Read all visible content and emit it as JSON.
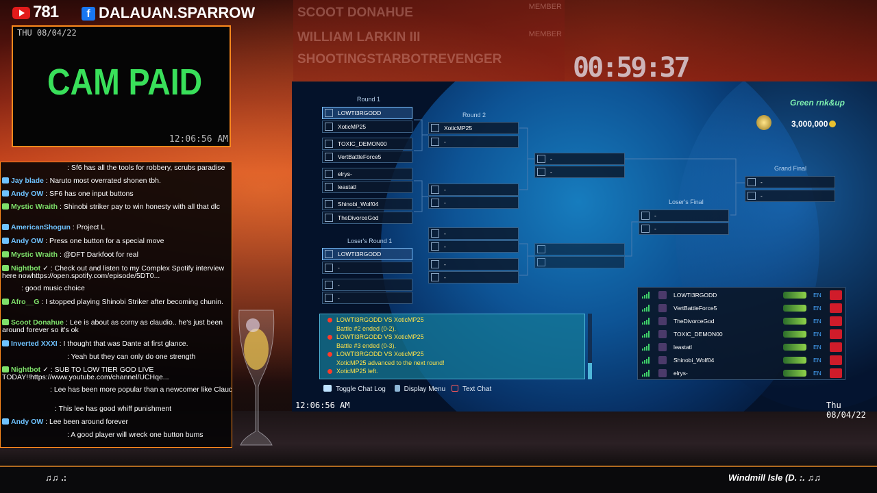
{
  "stats": {
    "youtube_count": "781",
    "facebook_name": "DALAUAN.SPARROW"
  },
  "cam": {
    "date": "THU 08/04/22",
    "label": "CAM PAID",
    "time": "12:06:56 AM"
  },
  "chat": [
    {
      "user": "",
      "text": ": Sf6 has all the tools for robbery, scrubs paradise",
      "color": "#ffffff"
    },
    {
      "user": "Jay blade",
      "text": ": Naruto most overrated shonen tbh.",
      "color": "#6fc3ff"
    },
    {
      "user": "Andy OW",
      "text": ": SF6 has one input buttons",
      "color": "#6fc3ff"
    },
    {
      "user": "Mystic Wraith",
      "text": ": Shinobi striker pay to win honesty with all that dlc",
      "color": "#7ee06a"
    },
    {
      "user": "AmericanShogun",
      "text": ": Project L",
      "color": "#6fc3ff"
    },
    {
      "user": "Andy OW",
      "text": ": Press one button for a special move",
      "color": "#6fc3ff"
    },
    {
      "user": "Mystic Wraith",
      "text": ": @DFT Darkfoot for real",
      "color": "#7ee06a"
    },
    {
      "user": "Nightbot",
      "text": "✓ : Check out and listen to my Complex Spotify interview here nowhttps://open.spotify.com/episode/5DT0...",
      "color": "#7ee06a"
    },
    {
      "user": "",
      "text": ": good music choice",
      "color": "#ffffff"
    },
    {
      "user": "Afro__G",
      "text": ": I stopped playing Shinobi Striker after becoming chunin.",
      "color": "#7ee06a"
    },
    {
      "user": "Scoot Donahue",
      "text": ": Lee is about as corny as claudio.. he's just been around forever so it's ok",
      "color": "#7ee06a"
    },
    {
      "user": "Inverted XXXI",
      "text": ": I thought that was Dante at first glance.",
      "color": "#6fc3ff"
    },
    {
      "user": "",
      "text": ": Yeah but they can only do one strength",
      "color": "#ffffff"
    },
    {
      "user": "Nightbot",
      "text": "✓ : SUB TO LOW TIER GOD LIVE TODAY!!https://www.youtube.com/channel/UCHqe...",
      "color": "#7ee06a"
    },
    {
      "user": "",
      "text": ": Lee has been more popular than a newcomer like Claudio",
      "color": "#ffffff"
    },
    {
      "user": "",
      "text": ": This lee has good whiff punishment",
      "color": "#ffffff"
    },
    {
      "user": "Andy OW",
      "text": ": Lee been around forever",
      "color": "#6fc3ff"
    },
    {
      "user": "",
      "text": ": A good player will wreck one button bums",
      "color": "#ffffff"
    }
  ],
  "ghost_list": [
    {
      "name": "SCOOT DONAHUE",
      "tag": "MEMBER"
    },
    {
      "name": "WILLIAM LARKIN III",
      "tag": "MEMBER"
    },
    {
      "name": "SHOOTINGSTARBOTREVENGER",
      "tag": ""
    }
  ],
  "timer": "00:59:37",
  "bracket": {
    "round1": "Round 1",
    "round2": "Round 2",
    "losers_round1": "Loser's Round 1",
    "losers_final": "Loser's Final",
    "grand_final": "Grand Final",
    "slots_round1": [
      "LOWTI3RGODD",
      "XoticMP25",
      "TOXIC_DEMON00",
      "VertBattleForce5",
      "elrys-",
      "leastatl",
      "Shinobi_Wolf04",
      "TheDivorceGod"
    ],
    "slot_round2_1": "XoticMP25",
    "slot_losers1_1": "LOWTI3RGODD",
    "empty": "-"
  },
  "prize": {
    "label": "Green rnk&up",
    "value": "3,000,000"
  },
  "log": [
    {
      "text": "LOWTI3RGODD VS XoticMP25",
      "dot": true
    },
    {
      "text": "Battle #2 ended (0-2).",
      "dot": false
    },
    {
      "text": "LOWTI3RGODD VS XoticMP25",
      "dot": true
    },
    {
      "text": "Battle #3 ended (0-3).",
      "dot": false
    },
    {
      "text": "LOWTI3RGODD VS XoticMP25",
      "dot": true
    },
    {
      "text": "XoticMP25 advanced to the next round!",
      "dot": false
    },
    {
      "text": "XoticMP25 left.",
      "dot": true
    }
  ],
  "hints": {
    "chat_log": "Toggle Chat Log",
    "display_menu": "Display Menu",
    "text_chat": "Text Chat"
  },
  "screen": {
    "time": "12:06:56 AM",
    "date": "Thu 08/04/22"
  },
  "players": [
    {
      "name": "LOWTI3RGODD",
      "lang": "EN"
    },
    {
      "name": "VertBattleForce5",
      "lang": "EN"
    },
    {
      "name": "TheDivorceGod",
      "lang": "EN"
    },
    {
      "name": "TOXIC_DEMON00",
      "lang": "EN"
    },
    {
      "name": "leastatl",
      "lang": "EN"
    },
    {
      "name": "Shinobi_Wolf04",
      "lang": "EN"
    },
    {
      "name": "elrys-",
      "lang": "EN"
    }
  ],
  "ticker": {
    "left": "♫♫ .:",
    "right": "Windmill Isle (D. :. ♫♫"
  }
}
